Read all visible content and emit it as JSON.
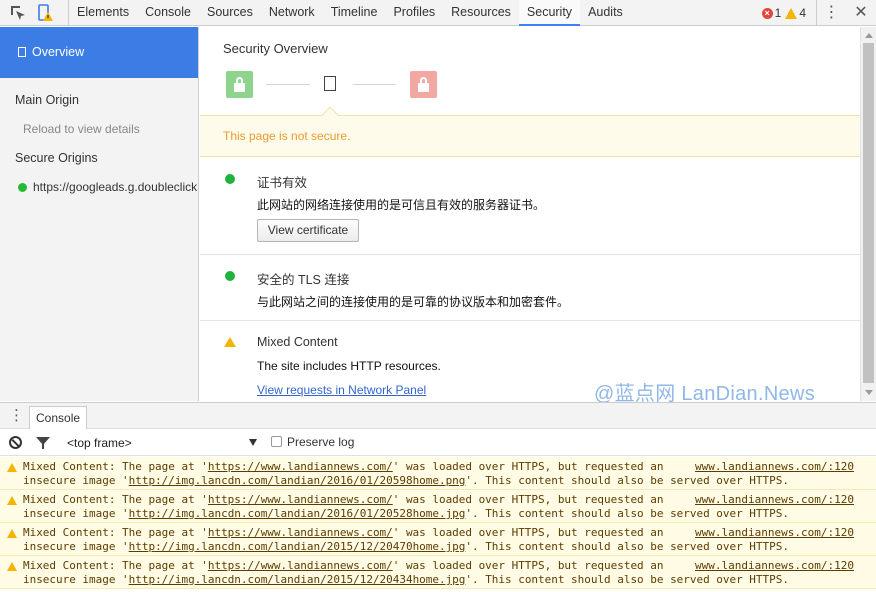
{
  "toolbar": {
    "tabs": [
      "Elements",
      "Console",
      "Sources",
      "Network",
      "Timeline",
      "Profiles",
      "Resources",
      "Security",
      "Audits"
    ],
    "active_tab": "Security",
    "error_count": "1",
    "warning_count": "4"
  },
  "sidebar": {
    "overview_label": "Overview",
    "main_origin_heading": "Main Origin",
    "reload_hint": "Reload to view details",
    "secure_origins_heading": "Secure Origins",
    "origin_url": "https://googleads.g.doubleclick.net"
  },
  "main": {
    "title": "Security Overview",
    "banner": "This page is not secure.",
    "items": [
      {
        "status": "secure",
        "title": "证书有效",
        "description": "此网站的网络连接使用的是可信且有效的服务器证书。",
        "button_label": "View certificate"
      },
      {
        "status": "secure",
        "title": "安全的 TLS 连接",
        "description": "与此网站之间的连接使用的是可靠的协议版本和加密套件。"
      },
      {
        "status": "warning",
        "title": "Mixed Content",
        "description": "The site includes HTTP resources.",
        "link_label": "View requests in Network Panel"
      }
    ],
    "watermark": "@蓝点网 LanDian.News"
  },
  "drawer": {
    "console_tab": "Console",
    "frame_select": "<top frame>",
    "preserve_log_label": "Preserve log"
  },
  "messages": [
    {
      "line1_pre": "Mixed Content: The page at '",
      "page_url": "https://www.landiannews.com/",
      "line1_post": "' was loaded over HTTPS, but requested an",
      "line2_pre": "insecure image '",
      "image_url": "http://img.lancdn.com/landian/2016/01/20598home.png",
      "line2_post": "'. This content should also be served over HTTPS.",
      "source": "www.landiannews.com/:120"
    },
    {
      "line1_pre": "Mixed Content: The page at '",
      "page_url": "https://www.landiannews.com/",
      "line1_post": "' was loaded over HTTPS, but requested an",
      "line2_pre": "insecure image '",
      "image_url": "http://img.lancdn.com/landian/2016/01/20528home.jpg",
      "line2_post": "'. This content should also be served over HTTPS.",
      "source": "www.landiannews.com/:120"
    },
    {
      "line1_pre": "Mixed Content: The page at '",
      "page_url": "https://www.landiannews.com/",
      "line1_post": "' was loaded over HTTPS, but requested an",
      "line2_pre": "insecure image '",
      "image_url": "http://img.lancdn.com/landian/2015/12/20470home.jpg",
      "line2_post": "'. This content should also be served over HTTPS.",
      "source": "www.landiannews.com/:120"
    },
    {
      "line1_pre": "Mixed Content: The page at '",
      "page_url": "https://www.landiannews.com/",
      "line1_post": "' was loaded over HTTPS, but requested an",
      "line2_pre": "insecure image '",
      "image_url": "http://img.lancdn.com/landian/2015/12/20434home.jpg",
      "line2_post": "'. This content should also be served over HTTPS.",
      "source": "www.landiannews.com/:120"
    }
  ]
}
